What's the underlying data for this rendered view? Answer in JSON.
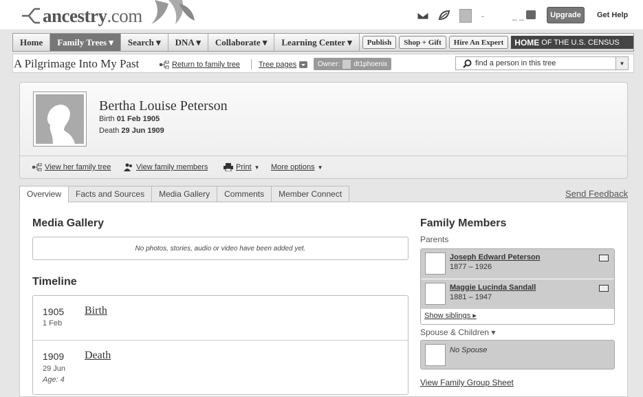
{
  "header": {
    "logo_text": "ancestry",
    "logo_suffix": ".com",
    "user_name": "-",
    "user_sub": "_ _",
    "upgrade_label": "Upgrade",
    "help_label": "Get Help"
  },
  "nav": {
    "items": [
      {
        "label": "Home"
      },
      {
        "label": "Family Trees ▾"
      },
      {
        "label": "Search ▾"
      },
      {
        "label": "DNA ▾"
      },
      {
        "label": "Collaborate ▾"
      },
      {
        "label": "Learning Center ▾"
      }
    ],
    "buttons": [
      "Publish",
      "Shop + Gift",
      "Hire An Expert"
    ],
    "census_bold": "HOME",
    "census_text": "OF THE U.S. CENSUS"
  },
  "tree_bar": {
    "title": "A Pilgrimage Into My Past",
    "return_link": "Return to family tree",
    "tree_pages": "Tree pages",
    "owner_label": "Owner:",
    "owner_name": "dt1phoenix",
    "search_placeholder": "find a person in this tree"
  },
  "person": {
    "name": "Bertha Louise Peterson",
    "birth_label": "Birth",
    "birth_date": "01 Feb 1905",
    "death_label": "Death",
    "death_date": "29 Jun 1909"
  },
  "profile_links": {
    "family_tree": "View her family tree",
    "family_members": "View family members",
    "print": "Print",
    "more_options": "More options"
  },
  "tabs": [
    "Overview",
    "Facts and Sources",
    "Media Gallery",
    "Comments",
    "Member Connect"
  ],
  "feedback": "Send Feedback",
  "media_gallery": {
    "title": "Media Gallery",
    "empty_text": "No photos, stories, audio or video have been added yet."
  },
  "timeline": {
    "title": "Timeline",
    "events": [
      {
        "year": "1905",
        "date": "1 Feb",
        "event": "Birth",
        "age": ""
      },
      {
        "year": "1909",
        "date": "29 Jun",
        "event": "Death",
        "age": "Age: 4"
      }
    ]
  },
  "family": {
    "title": "Family Members",
    "parents_label": "Parents",
    "parents": [
      {
        "name": "Joseph Edward Peterson",
        "years": "1877 – 1926"
      },
      {
        "name": "Maggie Lucinda Sandall",
        "years": "1881 – 1947"
      }
    ],
    "show_siblings": "Show siblings ▸",
    "spouse_label": "Spouse & Children ▾",
    "no_spouse": "No Spouse",
    "group_sheet": "View Family Group Sheet"
  }
}
